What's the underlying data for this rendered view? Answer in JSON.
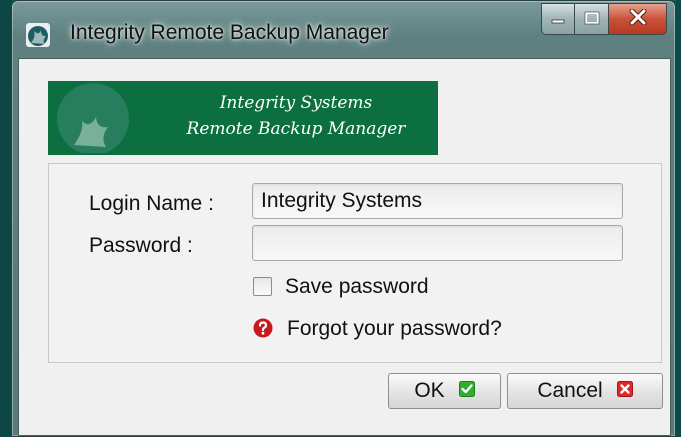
{
  "window": {
    "title": "Integrity Remote Backup Manager",
    "icon": "app-logo-icon"
  },
  "caption_buttons": {
    "minimize_icon": "minimize-icon",
    "maximize_icon": "maximize-icon",
    "close_icon": "close-icon"
  },
  "banner": {
    "line1": "Integrity Systems",
    "line2": "Remote Backup Manager",
    "color": "#0b6f3f"
  },
  "form": {
    "login_label": "Login Name :",
    "login_value": "Integrity Systems",
    "password_label": "Password :",
    "password_value": "",
    "save_password_label": "Save password",
    "save_password_checked": false,
    "forgot_link": "Forgot your password?"
  },
  "buttons": {
    "ok_label": "OK",
    "ok_icon": "check-icon",
    "ok_icon_color": "#2fae2f",
    "cancel_label": "Cancel",
    "cancel_icon": "cancel-x-icon",
    "cancel_icon_color": "#e0262b"
  }
}
